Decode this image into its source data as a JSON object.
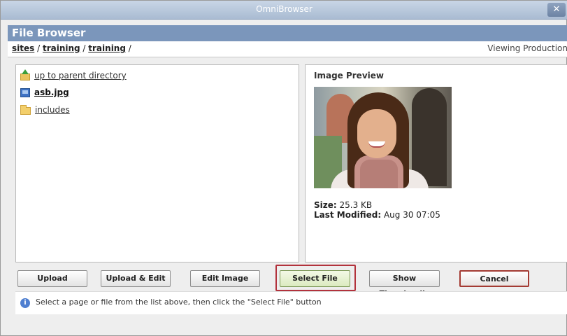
{
  "window": {
    "title": "OmniBrowser",
    "close_glyph": "✕"
  },
  "header": {
    "title": "File Browser"
  },
  "breadcrumb": {
    "items": [
      "sites",
      "training",
      "training"
    ],
    "separator": " / ",
    "trailing": " /",
    "viewing": "Viewing Production"
  },
  "files": [
    {
      "label": "up to parent directory",
      "icon": "folder-up-icon"
    },
    {
      "label": "asb.jpg",
      "icon": "image-file-icon",
      "selected": true
    },
    {
      "label": "includes",
      "icon": "folder-icon"
    }
  ],
  "preview": {
    "title": "Image Preview",
    "size_label": "Size:",
    "size_value": "25.3 KB",
    "modified_label": "Last Modified:",
    "modified_value": "Aug 30 07:05"
  },
  "buttons": {
    "upload": "Upload",
    "upload_edit": "Upload & Edit",
    "edit_image": "Edit Image",
    "select_file": "Select File",
    "show_thumbnails": "Show Thumbnails",
    "cancel": "Cancel"
  },
  "info": {
    "icon": "info-icon",
    "text": "Select a page or file from the list above, then click the \"Select File\" button"
  },
  "colors": {
    "header": "#7b96bb",
    "titlebar": "#a9bbd2",
    "highlight": "#b2323c"
  }
}
